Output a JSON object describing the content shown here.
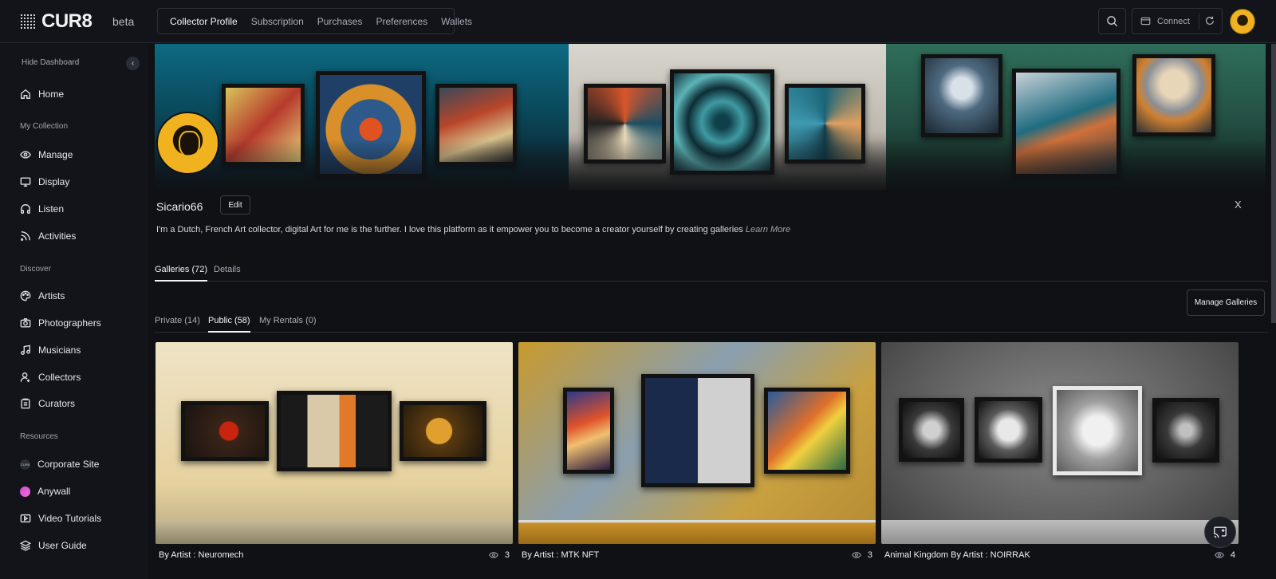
{
  "app": {
    "logo": "CUR8",
    "badge": "beta"
  },
  "topnav": {
    "items": [
      "Collector Profile",
      "Subscription",
      "Purchases",
      "Preferences",
      "Wallets"
    ],
    "active": "Collector Profile"
  },
  "header": {
    "connect_label": "Connect"
  },
  "sidebar": {
    "hide_label": "Hide Dashboard",
    "home": "Home",
    "sections": [
      {
        "label": "My Collection",
        "items": [
          "Manage",
          "Display",
          "Listen",
          "Activities"
        ]
      },
      {
        "label": "Discover",
        "items": [
          "Artists",
          "Photographers",
          "Musicians",
          "Collectors",
          "Curators"
        ]
      },
      {
        "label": "Resources",
        "items": [
          "Corporate Site",
          "Anywall",
          "Video Tutorials",
          "User Guide"
        ]
      }
    ]
  },
  "profile": {
    "username": "Sicario66",
    "edit_label": "Edit",
    "social_icon": "X",
    "bio": "I'm a Dutch, French Art collector, digital Art for me is the further. I love this platform as it empower you to become a creator yourself by creating galleries",
    "learn_more": "Learn More"
  },
  "tabs": [
    "Galleries (72)",
    "Details"
  ],
  "subtabs": [
    "Private (14)",
    "Public (58)",
    "My Rentals (0)"
  ],
  "manage_galleries_label": "Manage Galleries",
  "galleries": [
    {
      "title": "By Artist : Neuromech",
      "views": "3"
    },
    {
      "title": "By Artist : MTK NFT",
      "views": "3"
    },
    {
      "title": "Animal Kingdom By Artist : NOIRRAK",
      "views": "4"
    }
  ],
  "colors": {
    "accent": "#f0b21f",
    "background": "#0f1115",
    "sidebar": "#121419"
  }
}
